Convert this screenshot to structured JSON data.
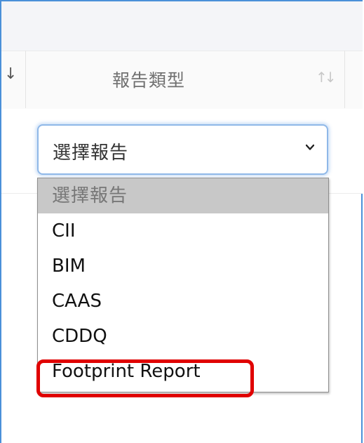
{
  "table": {
    "column_title": "報告類型",
    "left_sort_icon": "sort-down-icon",
    "sort_icon": "sort-both-icon"
  },
  "filter": {
    "select_value": "選擇報告",
    "options": [
      "選擇報告",
      "CII",
      "BIM",
      "CAAS",
      "CDDQ",
      "Footprint Report"
    ],
    "selected_index": 0,
    "highlighted_option": "Footprint Report"
  },
  "colors": {
    "accent": "#4a90d9",
    "highlight": "#e00000",
    "selected_option_bg": "#c8c8c8"
  }
}
